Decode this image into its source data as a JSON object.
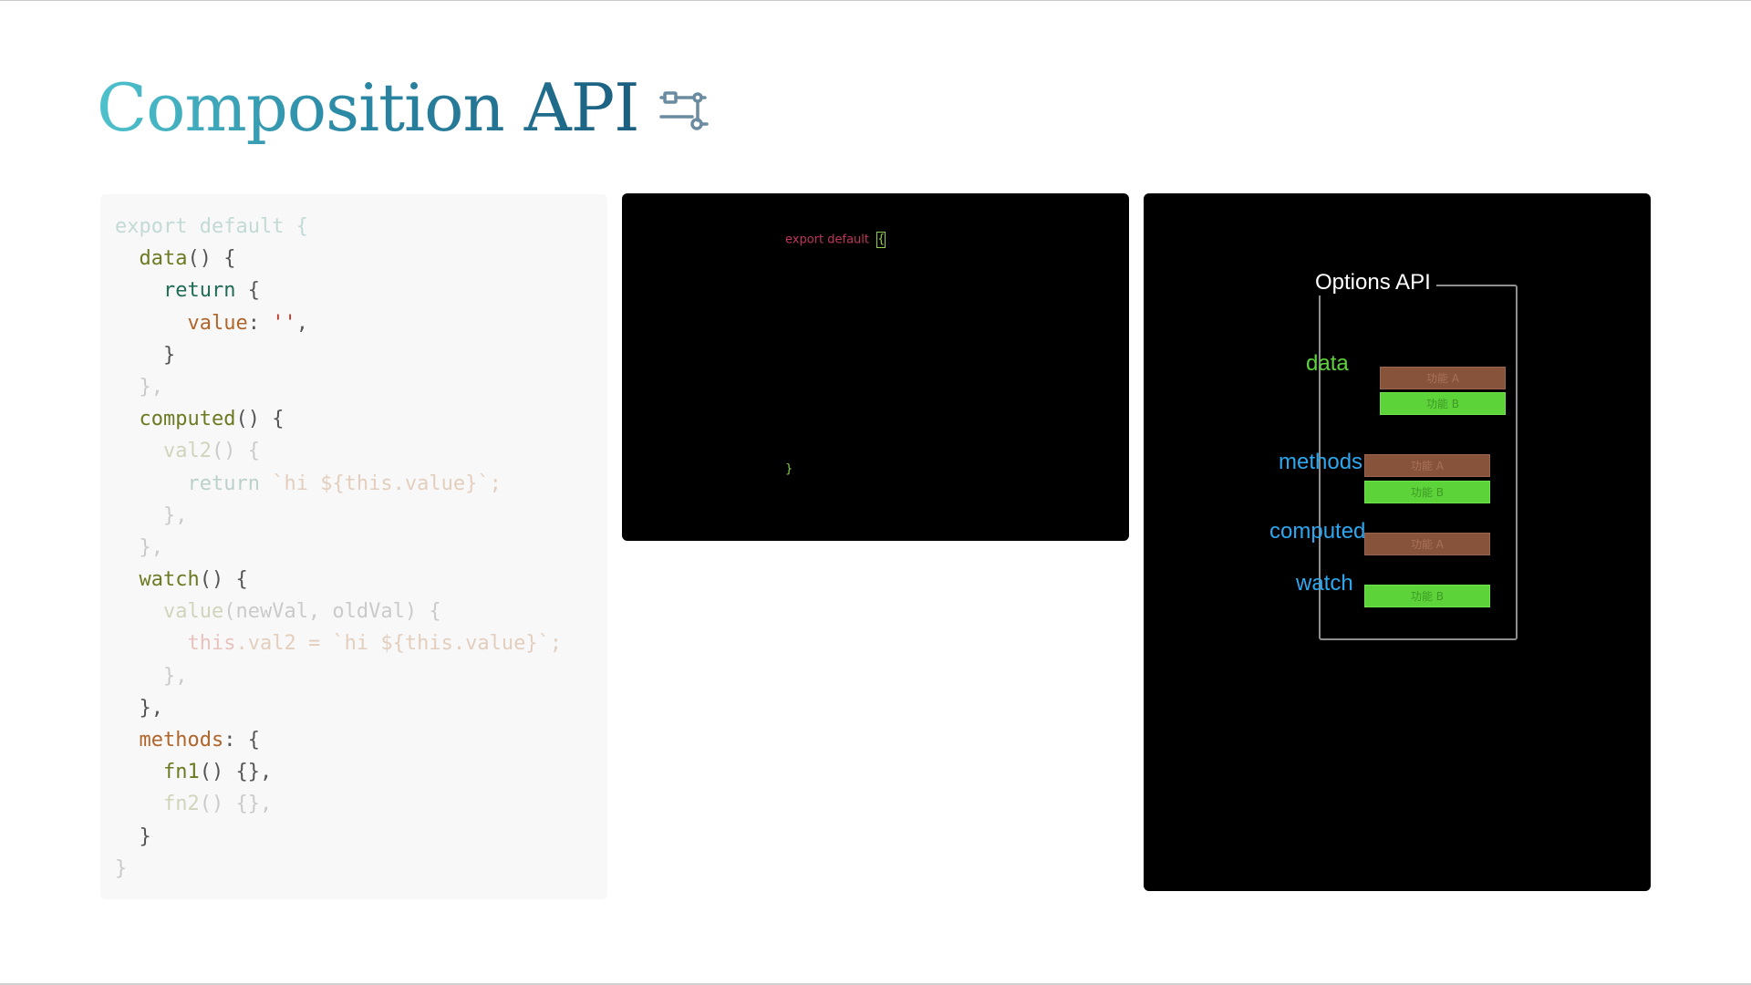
{
  "slide": {
    "title": "Composition API",
    "title_icon": "node-flow-icon"
  },
  "code_lines": [
    {
      "dim": true,
      "parts": [
        {
          "t": "export default {",
          "c": "t-kw"
        }
      ]
    },
    {
      "dim": false,
      "parts": [
        {
          "t": "  ",
          "c": ""
        },
        {
          "t": "data",
          "c": "t-key"
        },
        {
          "t": "() {",
          "c": "t-punc"
        }
      ]
    },
    {
      "dim": false,
      "parts": [
        {
          "t": "    ",
          "c": ""
        },
        {
          "t": "return",
          "c": "t-ret"
        },
        {
          "t": " {",
          "c": "t-punc"
        }
      ]
    },
    {
      "dim": false,
      "parts": [
        {
          "t": "      ",
          "c": ""
        },
        {
          "t": "value",
          "c": "t-prop"
        },
        {
          "t": ": ",
          "c": "t-punc"
        },
        {
          "t": "''",
          "c": "t-str"
        },
        {
          "t": ",",
          "c": "t-punc"
        }
      ]
    },
    {
      "dim": false,
      "parts": [
        {
          "t": "    }",
          "c": "t-punc"
        }
      ]
    },
    {
      "dim": true,
      "parts": [
        {
          "t": "  },",
          "c": "t-punc"
        }
      ]
    },
    {
      "dim": false,
      "parts": [
        {
          "t": "  ",
          "c": ""
        },
        {
          "t": "computed",
          "c": "t-key"
        },
        {
          "t": "() {",
          "c": "t-punc"
        }
      ]
    },
    {
      "dim": true,
      "parts": [
        {
          "t": "    ",
          "c": ""
        },
        {
          "t": "val2",
          "c": "t-key"
        },
        {
          "t": "() {",
          "c": "t-punc"
        }
      ]
    },
    {
      "dim": true,
      "parts": [
        {
          "t": "      ",
          "c": ""
        },
        {
          "t": "return",
          "c": "t-ret"
        },
        {
          "t": " `hi ${this.value}`;",
          "c": "t-prop"
        }
      ]
    },
    {
      "dim": true,
      "parts": [
        {
          "t": "    },",
          "c": "t-punc"
        }
      ]
    },
    {
      "dim": true,
      "parts": [
        {
          "t": "  },",
          "c": "t-punc"
        }
      ]
    },
    {
      "dim": false,
      "parts": [
        {
          "t": "  ",
          "c": ""
        },
        {
          "t": "watch",
          "c": "t-key"
        },
        {
          "t": "() {",
          "c": "t-punc"
        }
      ]
    },
    {
      "dim": true,
      "parts": [
        {
          "t": "    ",
          "c": ""
        },
        {
          "t": "value",
          "c": "t-key"
        },
        {
          "t": "(newVal, oldVal) {",
          "c": "t-punc"
        }
      ]
    },
    {
      "dim": true,
      "parts": [
        {
          "t": "      ",
          "c": ""
        },
        {
          "t": "this",
          "c": "t-str"
        },
        {
          "t": ".val2 = `hi ${this.value}`;",
          "c": "t-prop"
        }
      ]
    },
    {
      "dim": true,
      "parts": [
        {
          "t": "    },",
          "c": "t-punc"
        }
      ]
    },
    {
      "dim": false,
      "parts": [
        {
          "t": "  },",
          "c": "t-punc"
        }
      ]
    },
    {
      "dim": false,
      "parts": [
        {
          "t": "  ",
          "c": ""
        },
        {
          "t": "methods",
          "c": "t-prop"
        },
        {
          "t": ": {",
          "c": "t-punc"
        }
      ]
    },
    {
      "dim": false,
      "parts": [
        {
          "t": "    ",
          "c": ""
        },
        {
          "t": "fn1",
          "c": "t-key"
        },
        {
          "t": "() {},",
          "c": "t-punc"
        }
      ]
    },
    {
      "dim": true,
      "parts": [
        {
          "t": "    ",
          "c": ""
        },
        {
          "t": "fn2",
          "c": "t-key"
        },
        {
          "t": "() {},",
          "c": "t-punc"
        }
      ]
    },
    {
      "dim": false,
      "parts": [
        {
          "t": "  }",
          "c": "t-punc"
        }
      ]
    },
    {
      "dim": true,
      "parts": [
        {
          "t": "}",
          "c": "t-punc"
        }
      ]
    }
  ],
  "middle_panel": {
    "export_text": "export  default",
    "cursor_char": "{",
    "closing_brace": "}"
  },
  "right_panel": {
    "frame_title": "Options API",
    "labels": {
      "data": "data",
      "methods": "methods",
      "computed": "computed",
      "watch": "watch"
    },
    "features": {
      "data_a": "功能 A",
      "data_b": "功能 B",
      "methods_a": "功能 A",
      "methods_b": "功能 B",
      "computed_a": "功能 A",
      "watch_b": "功能 B"
    }
  },
  "colors": {
    "title_gradient_start": "#4ec2cc",
    "title_gradient_end": "#1b5e7f",
    "feature_a": "#87533a",
    "feature_b": "#5dd33a",
    "label_green": "#5dd33a",
    "label_blue": "#2fa7ef"
  }
}
